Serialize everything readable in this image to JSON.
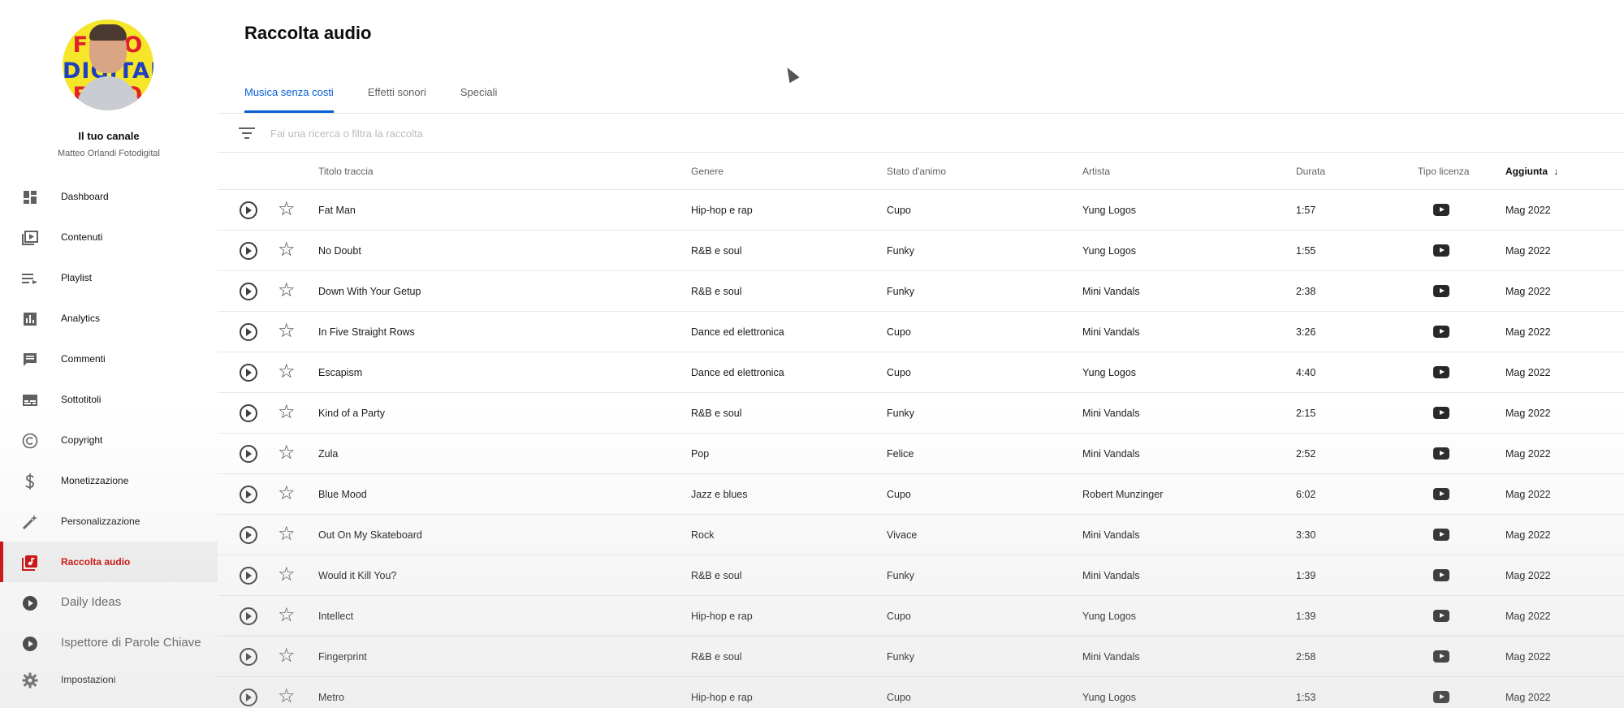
{
  "channel": {
    "title": "Il tuo canale",
    "name": "Matteo Orlandi Fotodigital",
    "logo_text": [
      "FOTO",
      "DIGITAL",
      "FOTO"
    ]
  },
  "nav": {
    "items": [
      {
        "label": "Dashboard",
        "icon": "dashboard-icon"
      },
      {
        "label": "Contenuti",
        "icon": "content-icon"
      },
      {
        "label": "Playlist",
        "icon": "playlist-icon"
      },
      {
        "label": "Analytics",
        "icon": "analytics-icon"
      },
      {
        "label": "Commenti",
        "icon": "comments-icon"
      },
      {
        "label": "Sottotitoli",
        "icon": "subtitles-icon"
      },
      {
        "label": "Copyright",
        "icon": "copyright-icon"
      },
      {
        "label": "Monetizzazione",
        "icon": "dollar-icon"
      },
      {
        "label": "Personalizzazione",
        "icon": "magic-wand-icon"
      },
      {
        "label": "Raccolta audio",
        "icon": "audio-library-icon",
        "active": true
      },
      {
        "label": "Daily Ideas",
        "icon": "extension-icon"
      },
      {
        "label": "Ispettore di Parole Chiave",
        "icon": "extension-icon"
      },
      {
        "label": "Impostazioni",
        "icon": "gear-icon"
      }
    ]
  },
  "page": {
    "title": "Raccolta audio"
  },
  "tabs": [
    {
      "label": "Musica senza costi",
      "active": true
    },
    {
      "label": "Effetti sonori",
      "active": false
    },
    {
      "label": "Speciali",
      "active": false
    }
  ],
  "filter": {
    "placeholder": "Fai una ricerca o filtra la raccolta"
  },
  "table": {
    "headers": {
      "title": "Titolo traccia",
      "genre": "Genere",
      "mood": "Stato d'animo",
      "artist": "Artista",
      "duration": "Durata",
      "license": "Tipo licenza",
      "added": "Aggiunta",
      "sort_arrow": "↓"
    },
    "rows": [
      {
        "title": "Fat Man",
        "genre": "Hip-hop e rap",
        "mood": "Cupo",
        "artist": "Yung Logos",
        "duration": "1:57",
        "added": "Mag 2022"
      },
      {
        "title": "No Doubt",
        "genre": "R&B e soul",
        "mood": "Funky",
        "artist": "Yung Logos",
        "duration": "1:55",
        "added": "Mag 2022"
      },
      {
        "title": "Down With Your Getup",
        "genre": "R&B e soul",
        "mood": "Funky",
        "artist": "Mini Vandals",
        "duration": "2:38",
        "added": "Mag 2022"
      },
      {
        "title": "In Five Straight Rows",
        "genre": "Dance ed elettronica",
        "mood": "Cupo",
        "artist": "Mini Vandals",
        "duration": "3:26",
        "added": "Mag 2022"
      },
      {
        "title": "Escapism",
        "genre": "Dance ed elettronica",
        "mood": "Cupo",
        "artist": "Yung Logos",
        "duration": "4:40",
        "added": "Mag 2022"
      },
      {
        "title": "Kind of a Party",
        "genre": "R&B e soul",
        "mood": "Funky",
        "artist": "Mini Vandals",
        "duration": "2:15",
        "added": "Mag 2022"
      },
      {
        "title": "Zula",
        "genre": "Pop",
        "mood": "Felice",
        "artist": "Mini Vandals",
        "duration": "2:52",
        "added": "Mag 2022"
      },
      {
        "title": "Blue Mood",
        "genre": "Jazz e blues",
        "mood": "Cupo",
        "artist": "Robert Munzinger",
        "duration": "6:02",
        "added": "Mag 2022"
      },
      {
        "title": "Out On My Skateboard",
        "genre": "Rock",
        "mood": "Vivace",
        "artist": "Mini Vandals",
        "duration": "3:30",
        "added": "Mag 2022"
      },
      {
        "title": "Would it Kill You?",
        "genre": "R&B e soul",
        "mood": "Funky",
        "artist": "Mini Vandals",
        "duration": "1:39",
        "added": "Mag 2022"
      },
      {
        "title": "Intellect",
        "genre": "Hip-hop e rap",
        "mood": "Cupo",
        "artist": "Yung Logos",
        "duration": "1:39",
        "added": "Mag 2022"
      },
      {
        "title": "Fingerprint",
        "genre": "R&B e soul",
        "mood": "Funky",
        "artist": "Mini Vandals",
        "duration": "2:58",
        "added": "Mag 2022"
      },
      {
        "title": "Metro",
        "genre": "Hip-hop e rap",
        "mood": "Cupo",
        "artist": "Yung Logos",
        "duration": "1:53",
        "added": "Mag 2022"
      }
    ]
  },
  "colors": {
    "accent": "#065fd4",
    "active_nav": "#cc0000"
  }
}
